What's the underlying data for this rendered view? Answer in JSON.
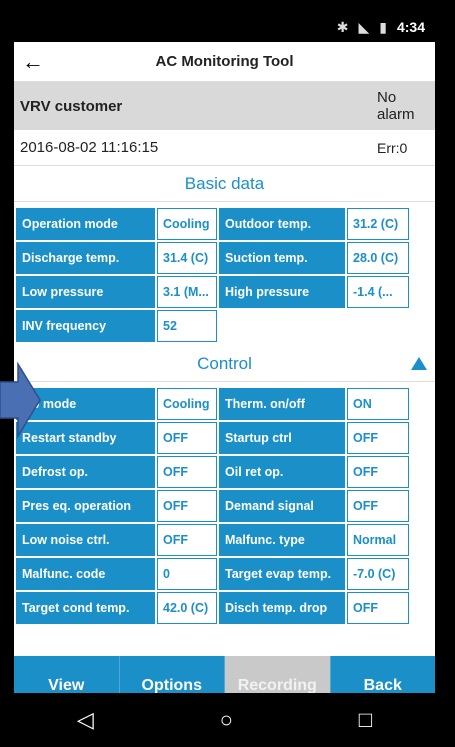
{
  "status": {
    "time": "4:34"
  },
  "appbar": {
    "title": "AC Monitoring Tool"
  },
  "customer": {
    "name": "VRV customer",
    "alarm": "No alarm"
  },
  "info": {
    "datetime": "2016-08-02 11:16:15",
    "error": "Err:0"
  },
  "basic": {
    "title": "Basic data",
    "rows": [
      [
        "Operation mode",
        "Cooling",
        "Outdoor temp.",
        "31.2 (C)"
      ],
      [
        "Discharge temp.",
        "31.4 (C)",
        "Suction temp.",
        "28.0 (C)"
      ],
      [
        "Low pressure",
        "3.1 (M...",
        "High pressure",
        "-1.4 (..."
      ],
      [
        "INV frequency",
        "52",
        "",
        ""
      ]
    ]
  },
  "control": {
    "title": "Control",
    "rows": [
      [
        "Op mode",
        "Cooling",
        "Therm. on/off",
        "ON"
      ],
      [
        "Restart standby",
        "OFF",
        "Startup ctrl",
        "OFF"
      ],
      [
        "Defrost op.",
        "OFF",
        "Oil ret op.",
        "OFF"
      ],
      [
        "Pres eq. operation",
        "OFF",
        "Demand signal",
        "OFF"
      ],
      [
        "Low noise ctrl.",
        "OFF",
        "Malfunc. type",
        "Normal"
      ],
      [
        "Malfunc. code",
        "0",
        "Target evap temp.",
        "-7.0 (C)"
      ],
      [
        "Target cond temp.",
        "42.0 (C)",
        "Disch temp. drop",
        "OFF"
      ]
    ]
  },
  "bottom": {
    "view": "View",
    "options": "Options",
    "recording": "Recording",
    "back": "Back"
  },
  "colors": {
    "accent": "#1b8fc8",
    "arrow": "#4a6fb3"
  }
}
